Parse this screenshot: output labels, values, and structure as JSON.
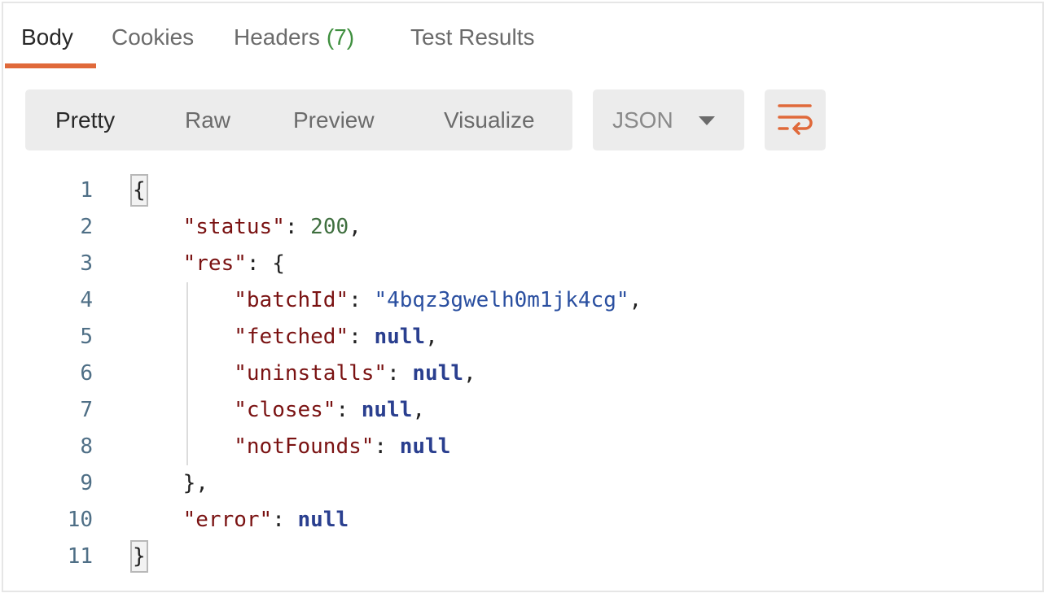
{
  "tabs": {
    "body": "Body",
    "cookies": "Cookies",
    "headers": "Headers",
    "headers_count": "(7)",
    "test_results": "Test Results"
  },
  "view_modes": {
    "pretty": "Pretty",
    "raw": "Raw",
    "preview": "Preview",
    "visualize": "Visualize"
  },
  "format_select": {
    "value": "JSON"
  },
  "wrap_icon": "wrap-lines-icon",
  "colors": {
    "accent": "#e0693a",
    "count_green": "#3f8f3f",
    "key": "#7a1212",
    "string": "#2a4fa0",
    "number": "#3f6f3f",
    "keyword": "#2a3f8f"
  },
  "code": {
    "line_numbers": [
      "1",
      "2",
      "3",
      "4",
      "5",
      "6",
      "7",
      "8",
      "9",
      "10",
      "11"
    ],
    "l1_open": "{",
    "l2_key": "\"status\"",
    "l2_val": "200",
    "l3_key": "\"res\"",
    "l3_open": "{",
    "l4_key": "\"batchId\"",
    "l4_val": "\"4bqz3gwelh0m1jk4cg\"",
    "l5_key": "\"fetched\"",
    "l5_val": "null",
    "l6_key": "\"uninstalls\"",
    "l6_val": "null",
    "l7_key": "\"closes\"",
    "l7_val": "null",
    "l8_key": "\"notFounds\"",
    "l8_val": "null",
    "l9_close": "},",
    "l10_key": "\"error\"",
    "l10_val": "null",
    "l11_close": "}"
  }
}
